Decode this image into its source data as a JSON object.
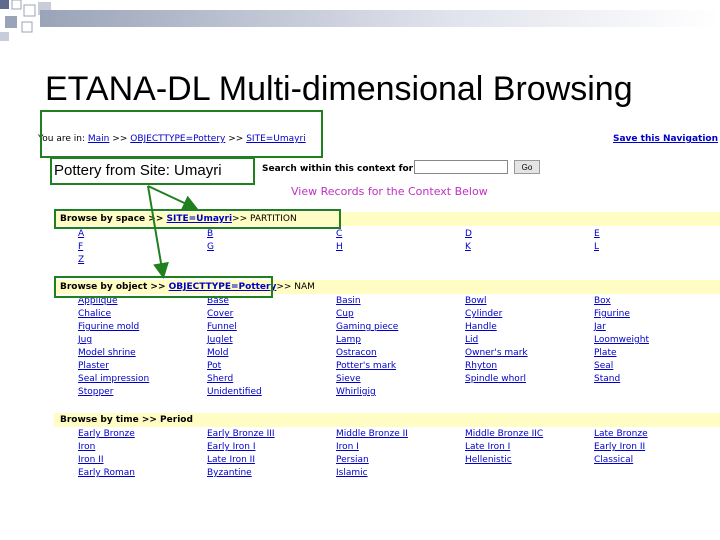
{
  "slide": {
    "title": "ETANA-DL Multi-dimensional Browsing",
    "annotation": "Pottery from Site: Umayri"
  },
  "breadcrumb": {
    "prefix": "You are in:",
    "main": "Main",
    "sep1": ">>",
    "objecttype": "OBJECTTYPE=Pottery",
    "sep2": ">>",
    "site": "SITE=Umayri"
  },
  "save_link": "Save this Navigation",
  "search": {
    "label": "Search within this context for",
    "value": "",
    "go_label": "Go"
  },
  "view_records": "View Records for the Context Below",
  "space": {
    "bar_label": "Browse by space >>",
    "bar_link": "SITE=Umayri",
    "bar_tail": ">> PARTITION",
    "items": [
      "A",
      "B",
      "C",
      "D",
      "E",
      "F",
      "G",
      "H",
      "K",
      "L",
      "Z"
    ]
  },
  "object": {
    "bar_label": "Browse by object >>",
    "bar_link": "OBJECTTYPE=Pottery",
    "bar_tail": ">> NAM",
    "items": [
      "Applique",
      "Base",
      "Basin",
      "Bowl",
      "Box",
      "Chalice",
      "Cover",
      "Cup",
      "Cylinder",
      "Figurine",
      "Figurine mold",
      "Funnel",
      "Gaming piece",
      "Handle",
      "Jar",
      "Jug",
      "Juglet",
      "Lamp",
      "Lid",
      "Loomweight",
      "Model shrine",
      "Mold",
      "Ostracon",
      "Owner's mark",
      "Plate",
      "Plaster",
      "Pot",
      "Potter's mark",
      "Rhyton",
      "Seal",
      "Seal impression",
      "Sherd",
      "Sieve",
      "Spindle whorl",
      "Stand",
      "Stopper",
      "Unidentified",
      "Whirligig"
    ]
  },
  "time": {
    "bar_label": "Browse by time >> Period",
    "items": [
      "Early Bronze",
      "Early Bronze III",
      "Middle Bronze II",
      "Middle Bronze IIC",
      "Late Bronze",
      "Iron",
      "Early Iron I",
      "Iron I",
      "Late Iron I",
      "Early Iron II",
      "Iron II",
      "Late Iron II",
      "Persian",
      "Hellenistic",
      "Classical",
      "Early Roman",
      "Byzantine",
      "Islamic"
    ]
  }
}
